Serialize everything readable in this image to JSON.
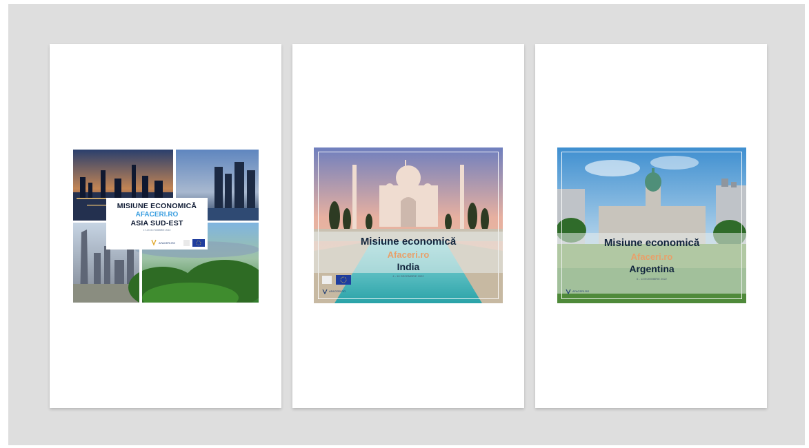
{
  "posters": [
    {
      "title_line1": "MISIUNE ECONOMICĂ",
      "title_line2": "AFACERI.RO",
      "title_line3": "ASIA SUD-EST",
      "date_line": "17-23 OCTOMBRIE 2022",
      "logo_left": "AFACERI.RO"
    },
    {
      "title_line1": "Misiune economică",
      "title_line2": "Afaceri.ro",
      "title_line3": "India",
      "date_line": "4 - 10 DECEMBRIE 2022",
      "logo_left": "AFACERI.RO"
    },
    {
      "title_line1": "Misiune economică",
      "title_line2": "Afaceri.ro",
      "title_line3": "Argentina",
      "date_line": "6 - 13 NOIEMBRIE 2022",
      "logo_left": "AFACERI.RO"
    }
  ],
  "colors": {
    "canvas": "#dedede",
    "page": "#ffffff",
    "navy": "#12253d",
    "accent_blue": "#3a9ee0",
    "accent_orange": "#e8a06a",
    "eu_blue": "#1f3d9e"
  },
  "icons": {
    "eu_flag": "eu-flag-icon",
    "brand_logo": "afaceri-logo-icon"
  }
}
